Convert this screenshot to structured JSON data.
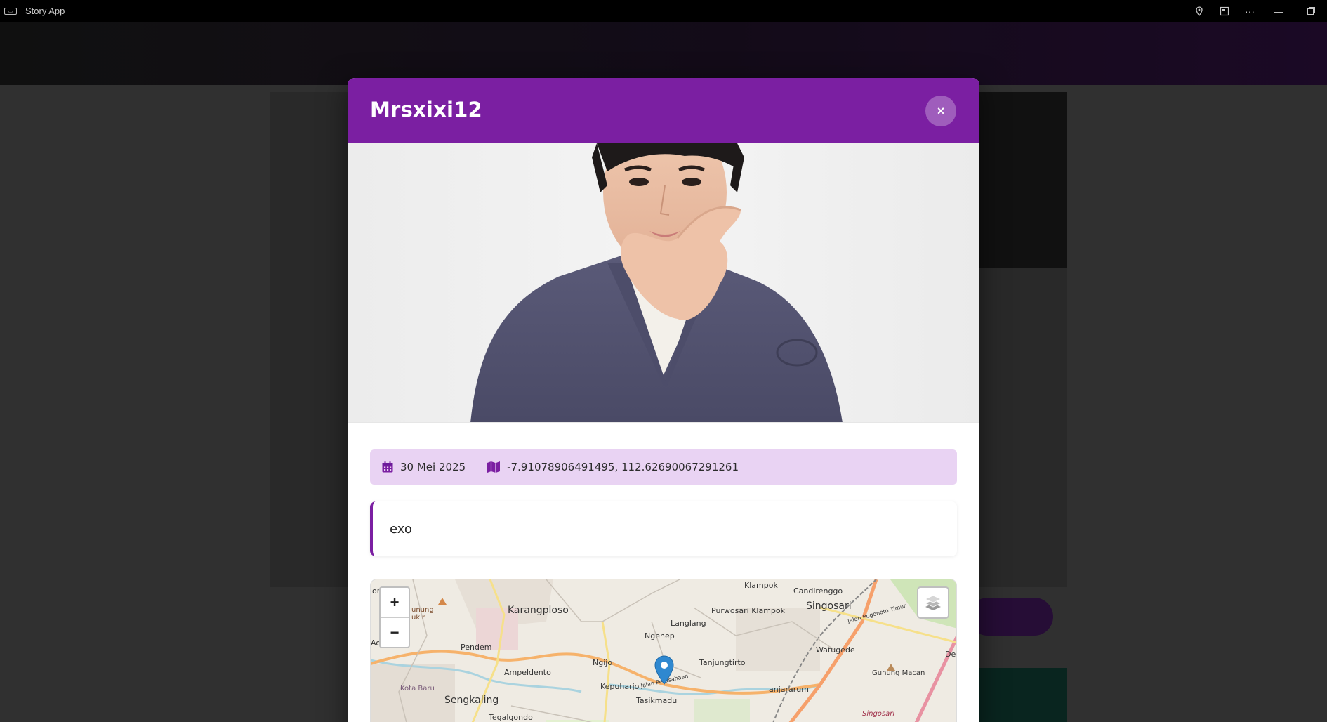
{
  "window": {
    "app_title": "Story App",
    "app_icon": "app-logo-icon",
    "controls": [
      "location-icon",
      "cast-icon",
      "more-icon",
      "minimize-icon",
      "restore-icon"
    ]
  },
  "modal": {
    "title": "Mrsxixi12",
    "close_label": "×",
    "date": "30 Mei 2025",
    "coordinates": "-7.91078906491495, 112.62690067291261",
    "description": "exo",
    "accent_color": "#7b1fa2",
    "meta_bg_color": "#e9d3f3"
  },
  "map": {
    "zoom_in": "+",
    "zoom_out": "−",
    "labels": {
      "klampok": "Klampok",
      "candirenggo": "Candirenggo",
      "singosari": "Singosari",
      "karangploso": "Karangploso",
      "purwosari_klampok": "Purwosari Klampok",
      "langlang": "Langlang",
      "ngenep": "Ngenep",
      "pendem": "Pendem",
      "watugede": "Watugede",
      "ngijo": "Ngijo",
      "tanjungtirto": "Tanjungtirto",
      "ampeldento": "Ampeldento",
      "kepuharjo": "Kepuharjo",
      "gunung_macan": "Gunung Macan",
      "jalan_perusahaan": "Jalan Perusahaan",
      "kota_baru": "Kota Baru",
      "sengkaling": "Sengkaling",
      "tasikmadu": "Tasikmadu",
      "anjararum": "anjararum",
      "tegalgondo": "Tegalgondo",
      "singosari_small": "Singosari",
      "gunung_ukir": "unung\nukir",
      "jalan_rogonoto": "Jalan Rogonoto Timur",
      "on": "on",
      "ao": "Ao",
      "de": "De"
    }
  }
}
